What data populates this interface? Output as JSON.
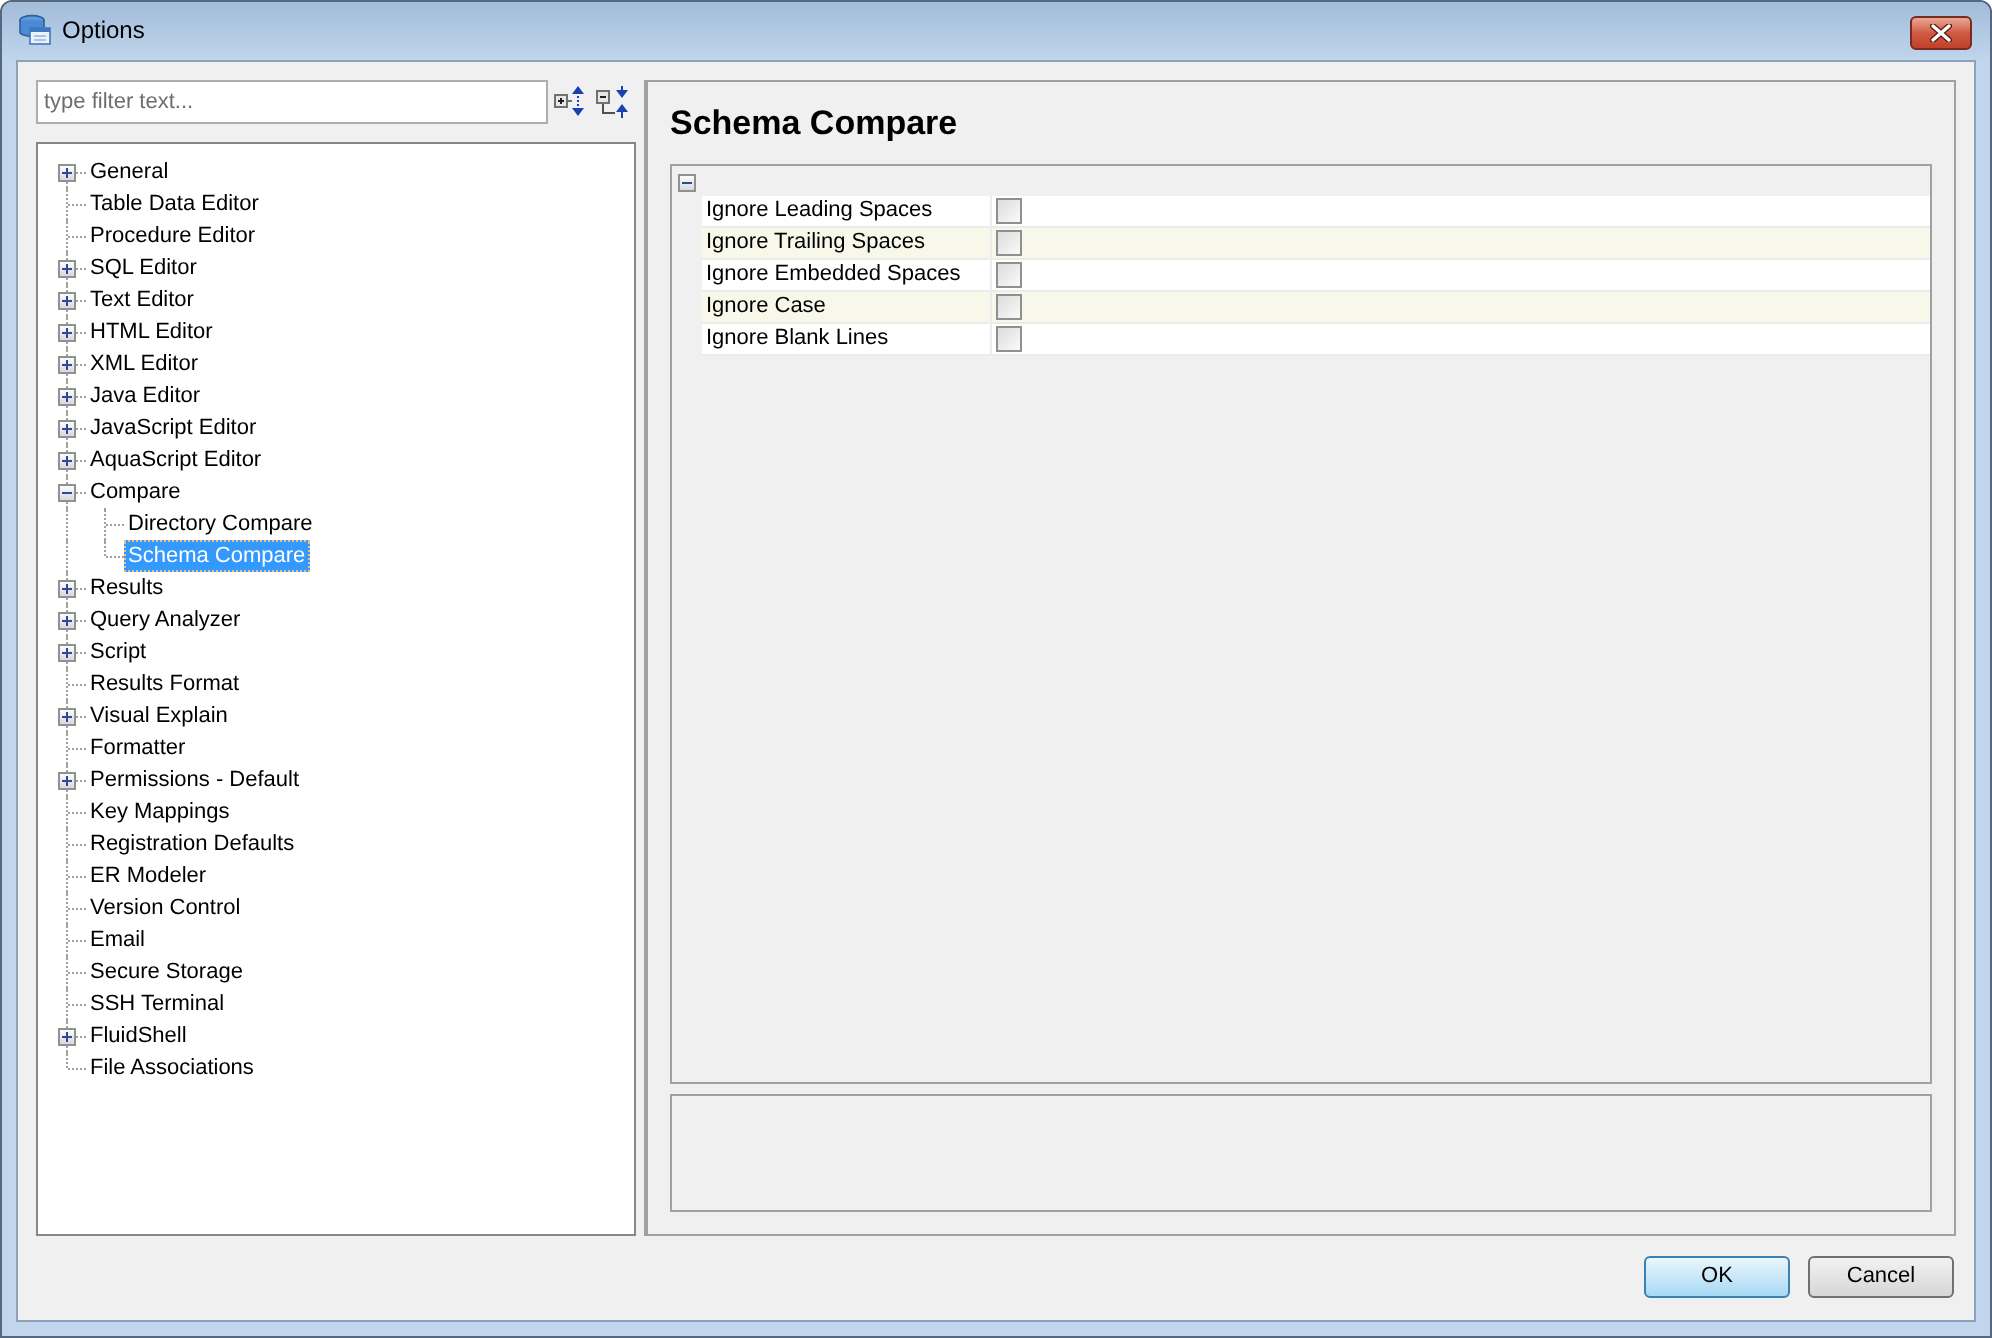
{
  "window": {
    "title": "Options"
  },
  "filter": {
    "placeholder": "type filter text..."
  },
  "tree": {
    "items": [
      {
        "label": "General",
        "kind": "group",
        "expanded": false,
        "selected": false
      },
      {
        "label": "Table Data Editor",
        "kind": "leaf",
        "selected": false
      },
      {
        "label": "Procedure Editor",
        "kind": "leaf",
        "selected": false
      },
      {
        "label": "SQL Editor",
        "kind": "group",
        "expanded": false,
        "selected": false
      },
      {
        "label": "Text Editor",
        "kind": "group",
        "expanded": false,
        "selected": false
      },
      {
        "label": "HTML Editor",
        "kind": "group",
        "expanded": false,
        "selected": false
      },
      {
        "label": "XML Editor",
        "kind": "group",
        "expanded": false,
        "selected": false
      },
      {
        "label": "Java Editor",
        "kind": "group",
        "expanded": false,
        "selected": false
      },
      {
        "label": "JavaScript Editor",
        "kind": "group",
        "expanded": false,
        "selected": false
      },
      {
        "label": "AquaScript Editor",
        "kind": "group",
        "expanded": false,
        "selected": false
      },
      {
        "label": "Compare",
        "kind": "group",
        "expanded": true,
        "selected": false,
        "children": [
          {
            "label": "Directory Compare",
            "kind": "leaf",
            "selected": false
          },
          {
            "label": "Schema Compare",
            "kind": "leaf",
            "selected": true
          }
        ]
      },
      {
        "label": "Results",
        "kind": "group",
        "expanded": false,
        "selected": false
      },
      {
        "label": "Query Analyzer",
        "kind": "group",
        "expanded": false,
        "selected": false
      },
      {
        "label": "Script",
        "kind": "group",
        "expanded": false,
        "selected": false
      },
      {
        "label": "Results Format",
        "kind": "leaf",
        "selected": false
      },
      {
        "label": "Visual Explain",
        "kind": "group",
        "expanded": false,
        "selected": false
      },
      {
        "label": "Formatter",
        "kind": "leaf",
        "selected": false
      },
      {
        "label": "Permissions - Default",
        "kind": "group",
        "expanded": false,
        "selected": false
      },
      {
        "label": "Key Mappings",
        "kind": "leaf",
        "selected": false
      },
      {
        "label": "Registration Defaults",
        "kind": "leaf",
        "selected": false
      },
      {
        "label": "ER Modeler",
        "kind": "leaf",
        "selected": false
      },
      {
        "label": "Version Control",
        "kind": "leaf",
        "selected": false
      },
      {
        "label": "Email",
        "kind": "leaf",
        "selected": false
      },
      {
        "label": "Secure Storage",
        "kind": "leaf",
        "selected": false
      },
      {
        "label": "SSH Terminal",
        "kind": "leaf",
        "selected": false
      },
      {
        "label": "FluidShell",
        "kind": "group",
        "expanded": false,
        "selected": false
      },
      {
        "label": "File Associations",
        "kind": "leaf",
        "selected": false
      }
    ]
  },
  "page": {
    "title": "Schema Compare",
    "section": {
      "expanded": true,
      "rows": [
        {
          "label": "Ignore Leading Spaces",
          "checked": false
        },
        {
          "label": "Ignore Trailing Spaces",
          "checked": false
        },
        {
          "label": "Ignore Embedded Spaces",
          "checked": false
        },
        {
          "label": "Ignore Case",
          "checked": false
        },
        {
          "label": "Ignore Blank Lines",
          "checked": false
        }
      ]
    }
  },
  "buttons": [
    {
      "label": "OK",
      "default": true
    },
    {
      "label": "Cancel",
      "default": false
    }
  ]
}
